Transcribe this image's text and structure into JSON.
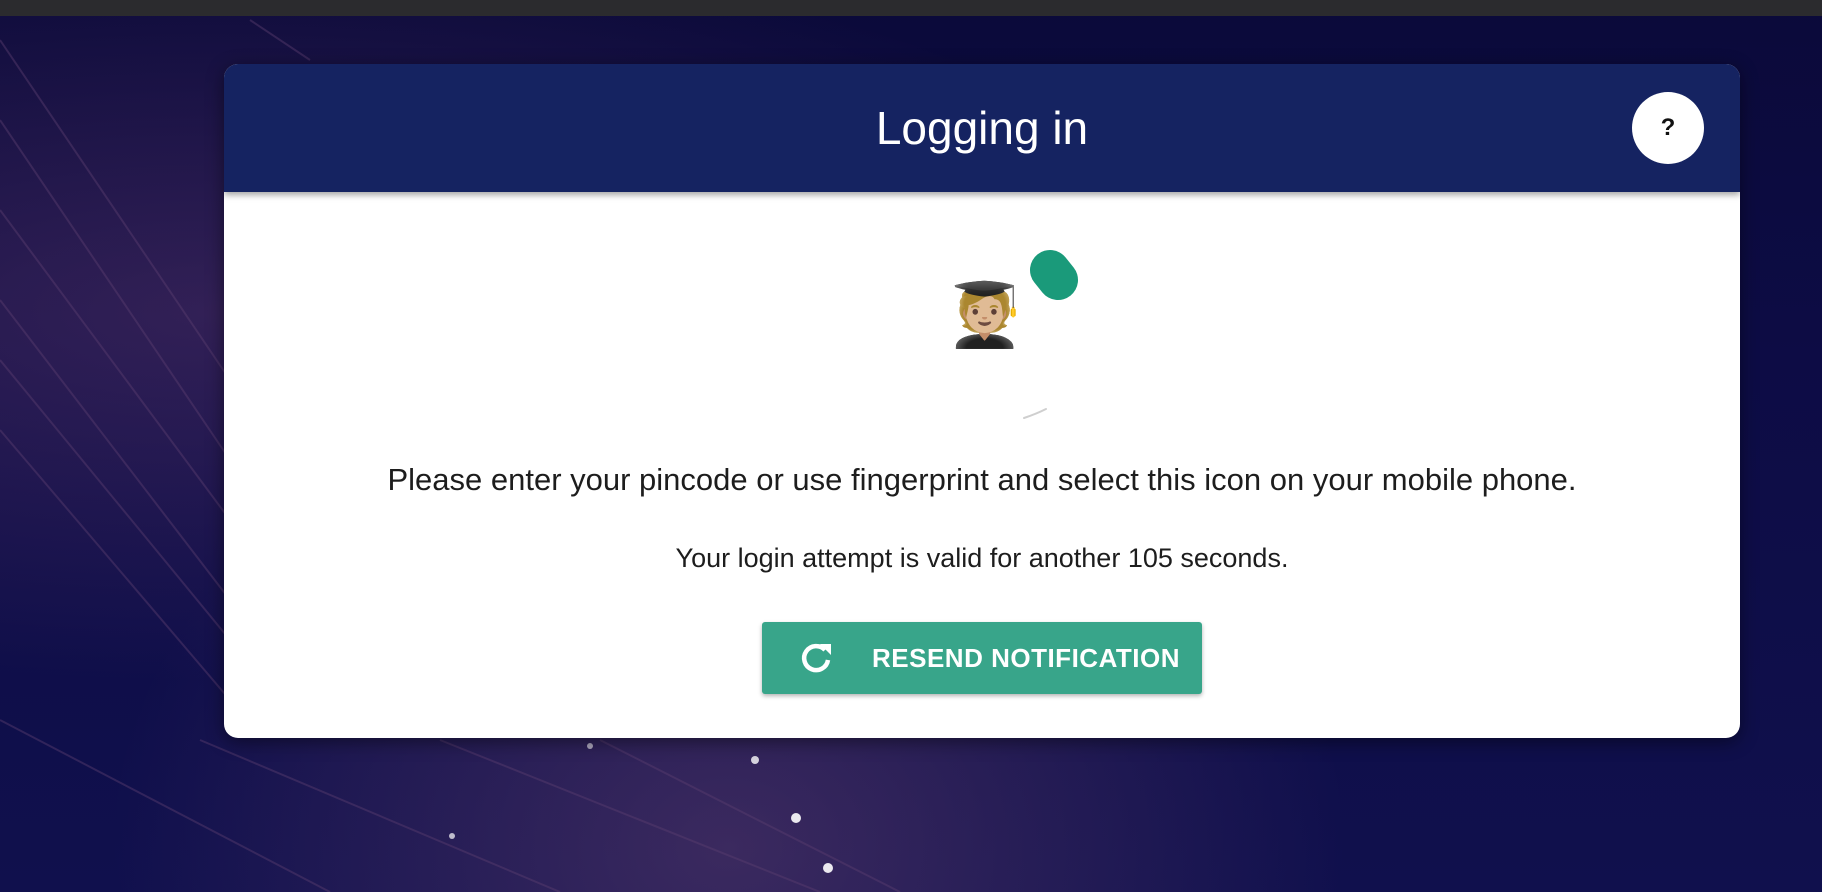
{
  "header": {
    "title": "Logging in",
    "help_label": "?"
  },
  "icon": {
    "name": "student-emoji",
    "glyph": "🧑🏼‍🎓"
  },
  "messages": {
    "instructions": "Please enter your pincode or use fingerprint and select this icon on your mobile phone.",
    "validity_prefix": "Your login attempt is valid for another ",
    "validity_seconds": "105",
    "validity_suffix": " seconds."
  },
  "actions": {
    "resend_label": "RESEND NOTIFICATION"
  },
  "colors": {
    "header_bg": "#152361",
    "accent_green": "#38a58a",
    "spinner_green": "#1a9a7a",
    "background": "#0d0c45"
  }
}
